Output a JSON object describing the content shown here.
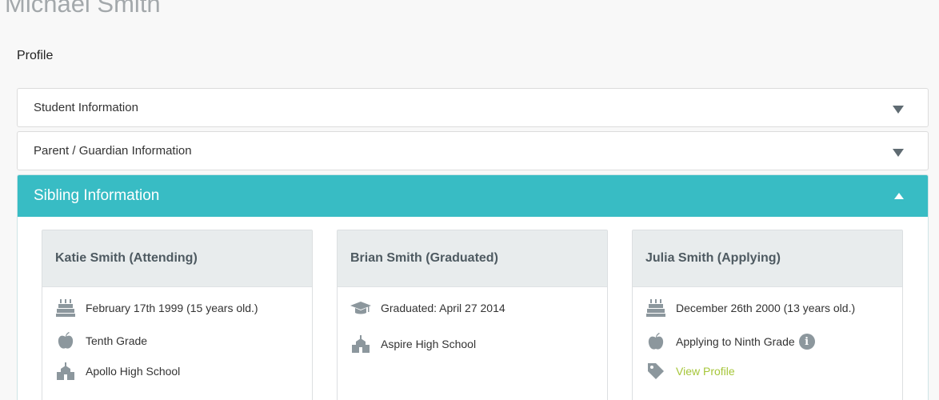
{
  "page": {
    "title": "Michael Smith",
    "section": "Profile"
  },
  "accordions": {
    "student": {
      "title": "Student Information"
    },
    "parent": {
      "title": "Parent / Guardian Information"
    },
    "sibling": {
      "title": "Sibling Information"
    }
  },
  "siblings": [
    {
      "name": "Katie Smith (Attending)",
      "birth": "February 17th 1999 (15 years old.)",
      "grade": "Tenth Grade",
      "school": "Apollo High School"
    },
    {
      "name": "Brian Smith (Graduated)",
      "graduated": "Graduated: April 27 2014",
      "school": "Aspire High School"
    },
    {
      "name": "Julia Smith (Applying)",
      "birth": "December 26th 2000 (13 years old.)",
      "grade": "Applying to Ninth Grade",
      "info_badge": "i",
      "link": "View Profile"
    }
  ],
  "colors": {
    "accent": "#38bcc4",
    "link": "#a6c63a",
    "icon": "#8c979d",
    "card_header": "#e8eced"
  },
  "icons": {
    "cake": "birthday-cake-icon",
    "apple": "apple-icon",
    "school": "school-icon",
    "graduation": "graduation-cap-icon",
    "tag": "tag-icon",
    "info": "info-icon"
  }
}
